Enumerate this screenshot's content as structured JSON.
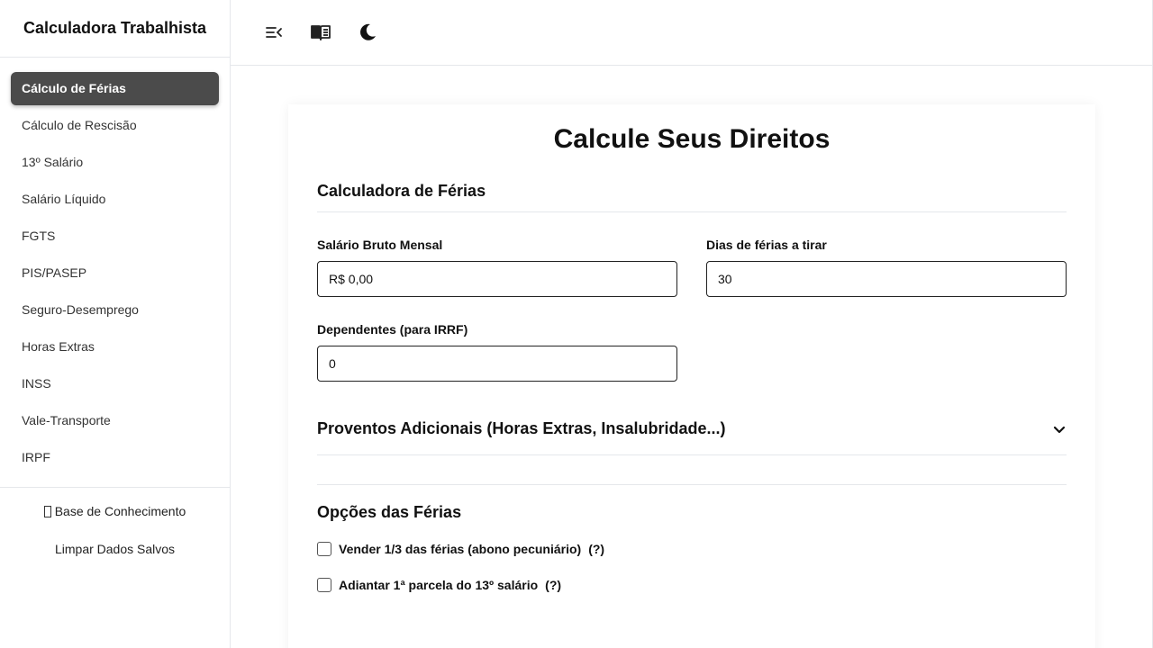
{
  "sidebar": {
    "title": "Calculadora Trabalhista",
    "items": [
      {
        "label": "Cálculo de Férias",
        "active": true
      },
      {
        "label": "Cálculo de Rescisão"
      },
      {
        "label": "13º Salário"
      },
      {
        "label": "Salário Líquido"
      },
      {
        "label": "FGTS"
      },
      {
        "label": "PIS/PASEP"
      },
      {
        "label": "Seguro-Desemprego"
      },
      {
        "label": "Horas Extras"
      },
      {
        "label": "INSS"
      },
      {
        "label": "Vale-Transporte"
      },
      {
        "label": "IRPF"
      }
    ],
    "footer": {
      "knowledge_base": "Base de Conhecimento",
      "clear_data": "Limpar Dados Salvos"
    }
  },
  "topbar": {
    "icons": [
      "collapse-menu-icon",
      "book-icon",
      "moon-icon"
    ]
  },
  "main": {
    "page_title": "Calcule Seus Direitos",
    "section_title": "Calculadora de Férias",
    "fields": {
      "salary": {
        "label": "Salário Bruto Mensal",
        "value": "R$ 0,00"
      },
      "vacation_days": {
        "label": "Dias de férias a tirar",
        "value": "30"
      },
      "dependents": {
        "label": "Dependentes (para IRRF)",
        "value": "0"
      }
    },
    "accordion_title": "Proventos Adicionais (Horas Extras, Insalubridade...)",
    "options_title": "Opções das Férias",
    "options": [
      {
        "label": "Vender 1/3 das férias (abono pecuniário)",
        "help": "(?)",
        "checked": false
      },
      {
        "label": "Adiantar 1ª parcela do 13º salário",
        "help": "(?)",
        "checked": false
      }
    ]
  },
  "colors": {
    "active_nav_bg": "#4b4b4b",
    "border": "#e5e7eb"
  }
}
